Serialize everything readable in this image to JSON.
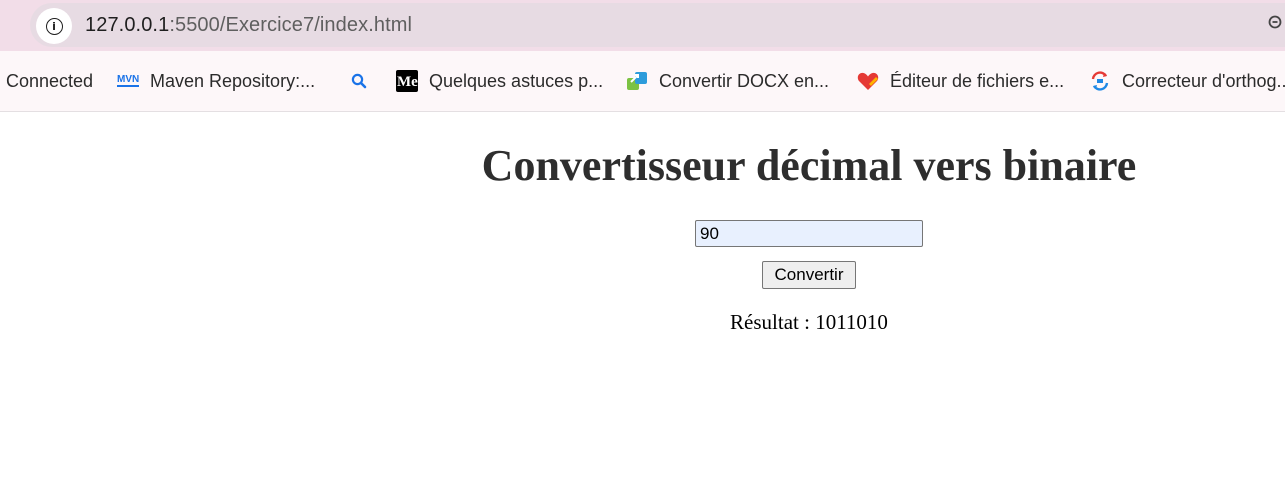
{
  "browser": {
    "url_host": "127.0.0.1",
    "url_rest": ":5500/Exercice7/index.html",
    "icons": {
      "site_info": "info-icon",
      "zoom": "zoom-icon"
    }
  },
  "bookmarks": [
    {
      "label": "Connected",
      "icon": "none"
    },
    {
      "label": "Maven Repository:...",
      "icon": "maven-icon"
    },
    {
      "label": "",
      "icon": "search-icon"
    },
    {
      "label": "Quelques astuces p...",
      "icon": "medium-icon"
    },
    {
      "label": "Convertir DOCX en...",
      "icon": "convert-icon"
    },
    {
      "label": "Éditeur de fichiers e...",
      "icon": "heart-edit-icon"
    },
    {
      "label": "Correcteur d'orthog...",
      "icon": "spellcheck-icon"
    }
  ],
  "page": {
    "title": "Convertisseur décimal vers binaire",
    "input_value": "90",
    "button_label": "Convertir",
    "result_text": "Résultat : 1011010"
  },
  "colors": {
    "address_bar_bg": "#f2dde8",
    "bookmarks_bg": "#fdf7f9",
    "input_autofill_bg": "#e8f0fe",
    "title_color": "#2e2e2e"
  }
}
